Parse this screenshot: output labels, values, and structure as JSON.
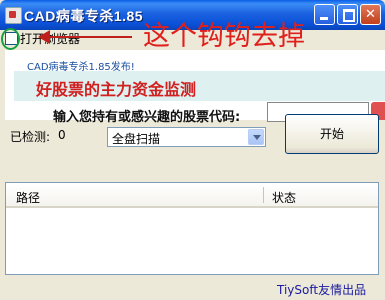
{
  "window": {
    "title": "CAD病毒专杀1.85"
  },
  "checkbox": {
    "label": "打开浏览器",
    "checked": false
  },
  "annotation": {
    "text": "这个钩钩去掉",
    "color": "#e0201c"
  },
  "web": {
    "heading": "CAD病毒专杀1.85发布!",
    "banner_title": "好股票的主力资金监测",
    "prompt": "输入您持有或感兴趣的股票代码:"
  },
  "scan": {
    "detected_label": "已检测:",
    "detected_value": "0",
    "mode_selected": "全盘扫描",
    "start_label": "开始"
  },
  "list": {
    "columns": [
      "路径",
      "状态"
    ],
    "rows": []
  },
  "footer": {
    "text": "TiySoft友情出品"
  }
}
